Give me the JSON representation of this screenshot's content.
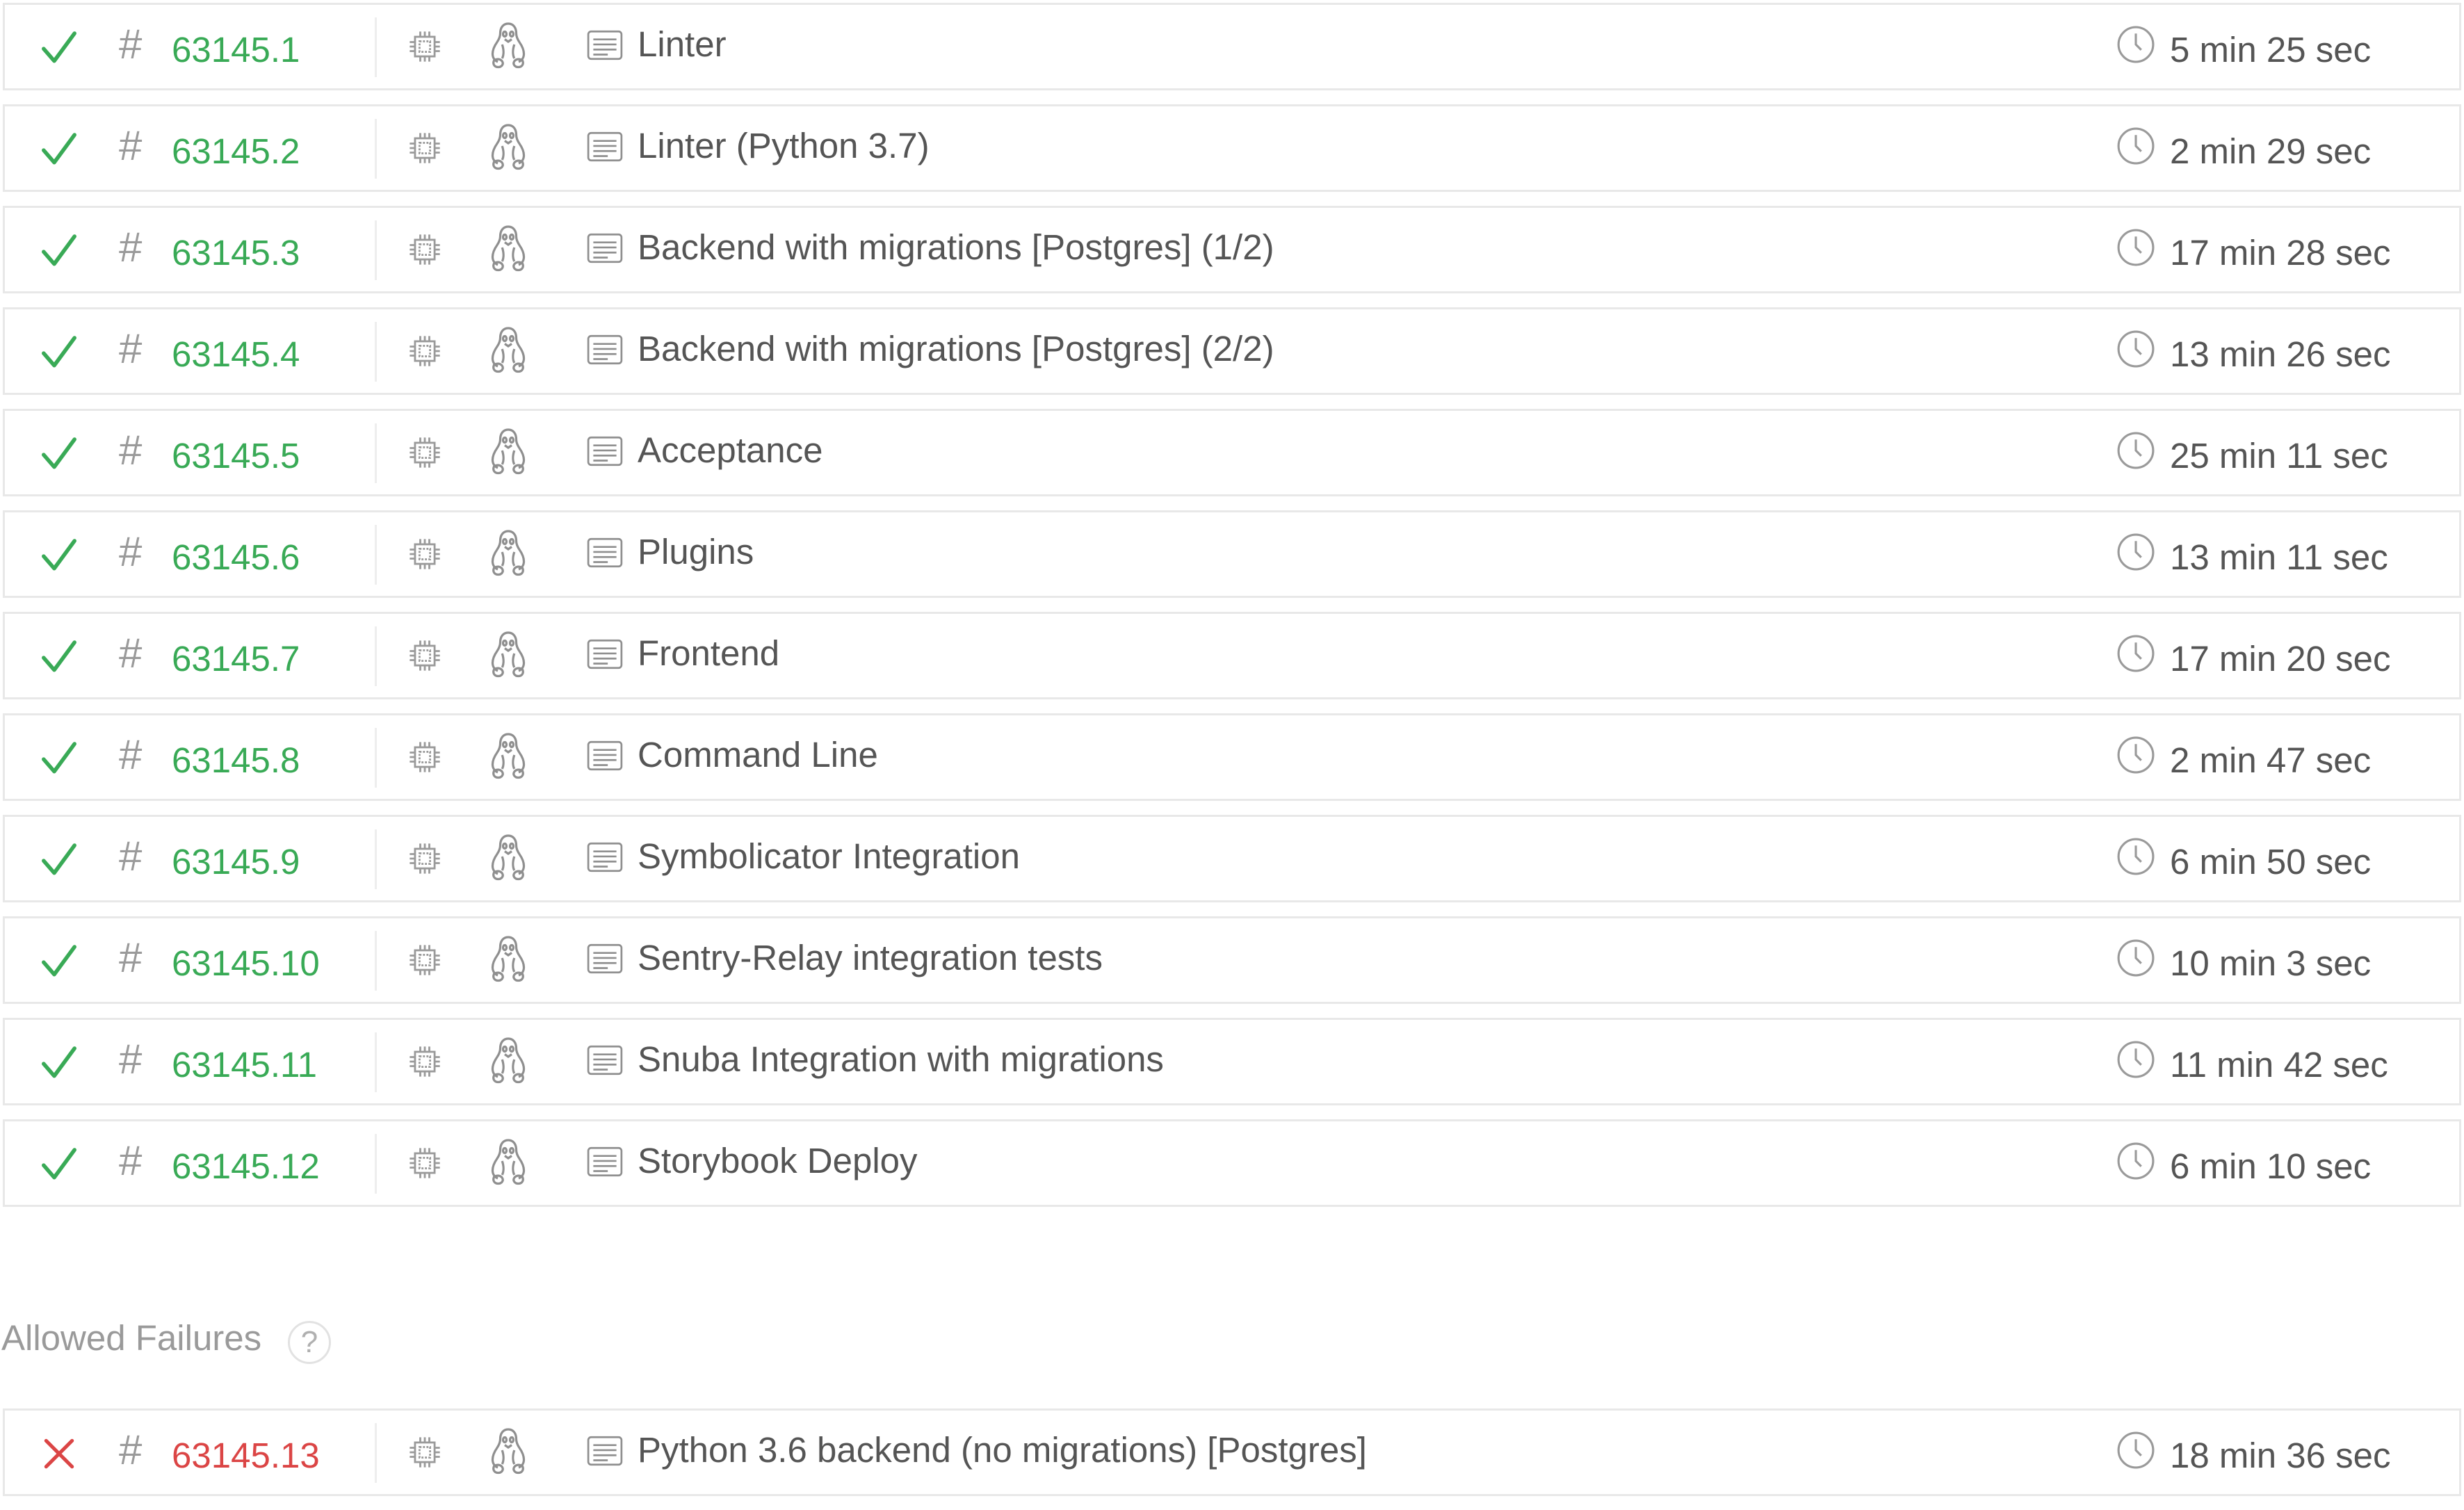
{
  "colors": {
    "passed": "#39aa56",
    "failed": "#db4545",
    "text": "#555555",
    "muted": "#9a9a9a",
    "border": "#e8e8e8"
  },
  "icons": {
    "status_passed": "check-icon",
    "status_failed": "cross-icon",
    "number_prefix": "hash-icon",
    "architecture": "cpu-icon",
    "os": "linux-tux-icon",
    "job_name": "document-icon",
    "duration": "clock-icon"
  },
  "hash_symbol": "#",
  "jobs": [
    {
      "status": "passed",
      "number": "63145.1",
      "name": "Linter",
      "duration": "5 min 25 sec"
    },
    {
      "status": "passed",
      "number": "63145.2",
      "name": "Linter (Python 3.7)",
      "duration": "2 min 29 sec"
    },
    {
      "status": "passed",
      "number": "63145.3",
      "name": "Backend with migrations [Postgres] (1/2)",
      "duration": "17 min 28 sec"
    },
    {
      "status": "passed",
      "number": "63145.4",
      "name": "Backend with migrations [Postgres] (2/2)",
      "duration": "13 min 26 sec"
    },
    {
      "status": "passed",
      "number": "63145.5",
      "name": "Acceptance",
      "duration": "25 min 11 sec"
    },
    {
      "status": "passed",
      "number": "63145.6",
      "name": "Plugins",
      "duration": "13 min 11 sec"
    },
    {
      "status": "passed",
      "number": "63145.7",
      "name": "Frontend",
      "duration": "17 min 20 sec"
    },
    {
      "status": "passed",
      "number": "63145.8",
      "name": "Command Line",
      "duration": "2 min 47 sec"
    },
    {
      "status": "passed",
      "number": "63145.9",
      "name": "Symbolicator Integration",
      "duration": "6 min 50 sec"
    },
    {
      "status": "passed",
      "number": "63145.10",
      "name": "Sentry-Relay integration tests",
      "duration": "10 min 3 sec"
    },
    {
      "status": "passed",
      "number": "63145.11",
      "name": "Snuba Integration with migrations",
      "duration": "11 min 42 sec"
    },
    {
      "status": "passed",
      "number": "63145.12",
      "name": "Storybook Deploy",
      "duration": "6 min 10 sec"
    }
  ],
  "allowed_failures": {
    "title": "Allowed Failures",
    "help_label": "?",
    "jobs": [
      {
        "status": "failed",
        "number": "63145.13",
        "name": "Python 3.6 backend (no migrations) [Postgres]",
        "duration": "18 min 36 sec"
      }
    ]
  }
}
